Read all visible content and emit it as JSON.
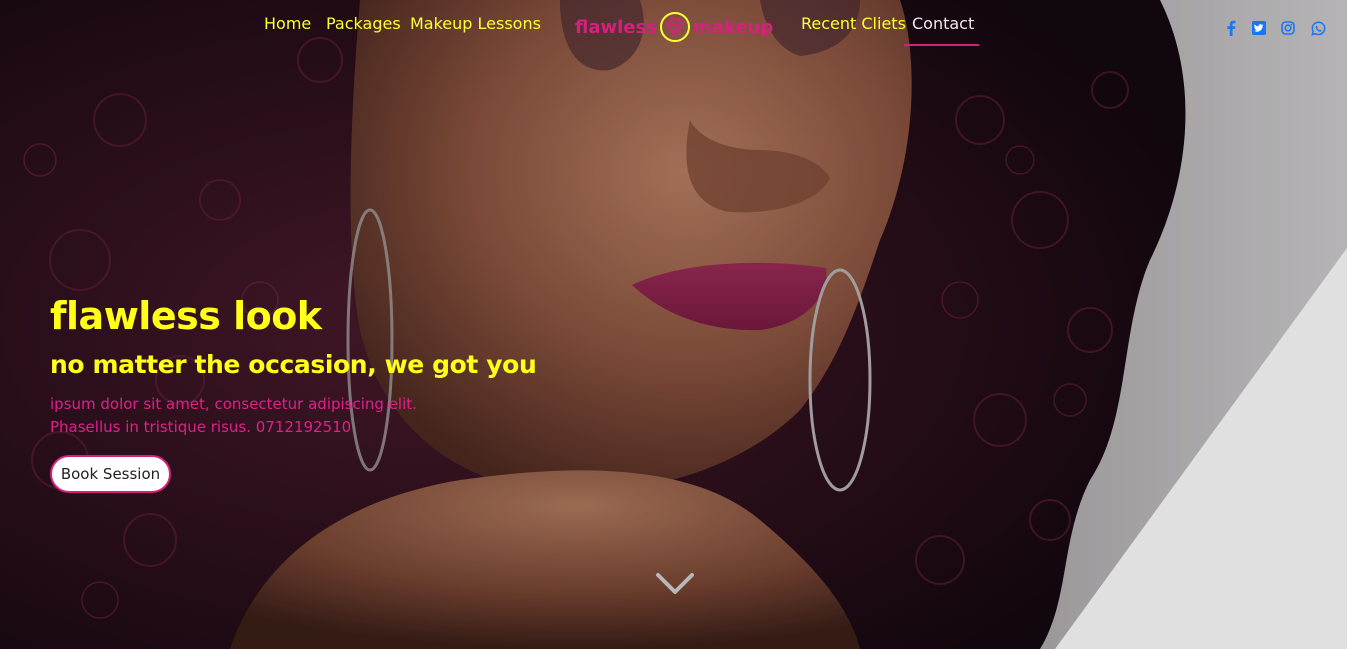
{
  "nav": {
    "items": [
      {
        "label": "Home"
      },
      {
        "label": "Packages"
      },
      {
        "label": "Makeup Lessons"
      },
      {
        "label": "Recent Cliets"
      },
      {
        "label": "Contact",
        "active": true
      }
    ],
    "brand_left": "flawless",
    "brand_right": "makeup",
    "brand_icon": "diamond-icon"
  },
  "social": [
    {
      "icon": "facebook-icon"
    },
    {
      "icon": "twitter-icon"
    },
    {
      "icon": "instagram-icon"
    },
    {
      "icon": "whatsapp-icon"
    }
  ],
  "hero": {
    "title": "flawless look",
    "subtitle": "no matter the occasion, we got you",
    "body_line1": "ipsum dolor sit amet, consectetur adipiscing elit.",
    "body_line2": "Phasellus in tristique risus. 0712192510",
    "cta": "Book Session",
    "scroll_icon": "chevron-down-icon"
  },
  "colors": {
    "accent_yellow": "#ffff33",
    "accent_pink": "#d6207e",
    "social_blue": "#1877f2"
  }
}
